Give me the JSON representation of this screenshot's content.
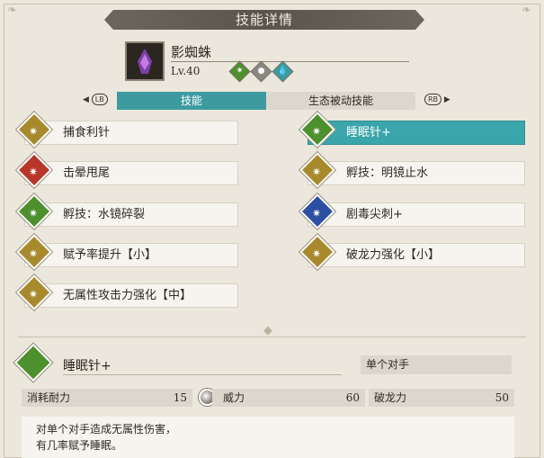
{
  "window": {
    "title": "技能详情"
  },
  "monster": {
    "name": "影蜘蛛",
    "level": "Lv.40",
    "elements": [
      "green-element-icon",
      "neutral-element-icon",
      "water-element-icon"
    ]
  },
  "tabs": {
    "lb": "LB",
    "rb": "RB",
    "active": "技能",
    "inactive": "生态被动技能"
  },
  "skills_left": [
    "捕食利针",
    "击晕甩尾",
    "孵技：水镜碎裂",
    "赋予率提升【小】",
    "无属性攻击力强化【中】"
  ],
  "skills_right": [
    "睡眠针+",
    "孵技：明镜止水",
    "剧毒尖刺+",
    "破龙力强化【小】"
  ],
  "detail": {
    "title": "睡眠针+",
    "target": "单个对手",
    "stamina_label": "消耗耐力",
    "stamina_value": "15",
    "power_label": "威力",
    "power_value": "60",
    "dragon_label": "破龙力",
    "dragon_value": "50",
    "desc_line1": "对单个对手造成无属性伤害，",
    "desc_line2": "有几率赋予睡眠。"
  },
  "colors": {
    "accent": "#3aa5ab",
    "gold": "#a88a2d",
    "green": "#4e8f2e",
    "red": "#b8372a",
    "blue": "#2d4fa3"
  }
}
